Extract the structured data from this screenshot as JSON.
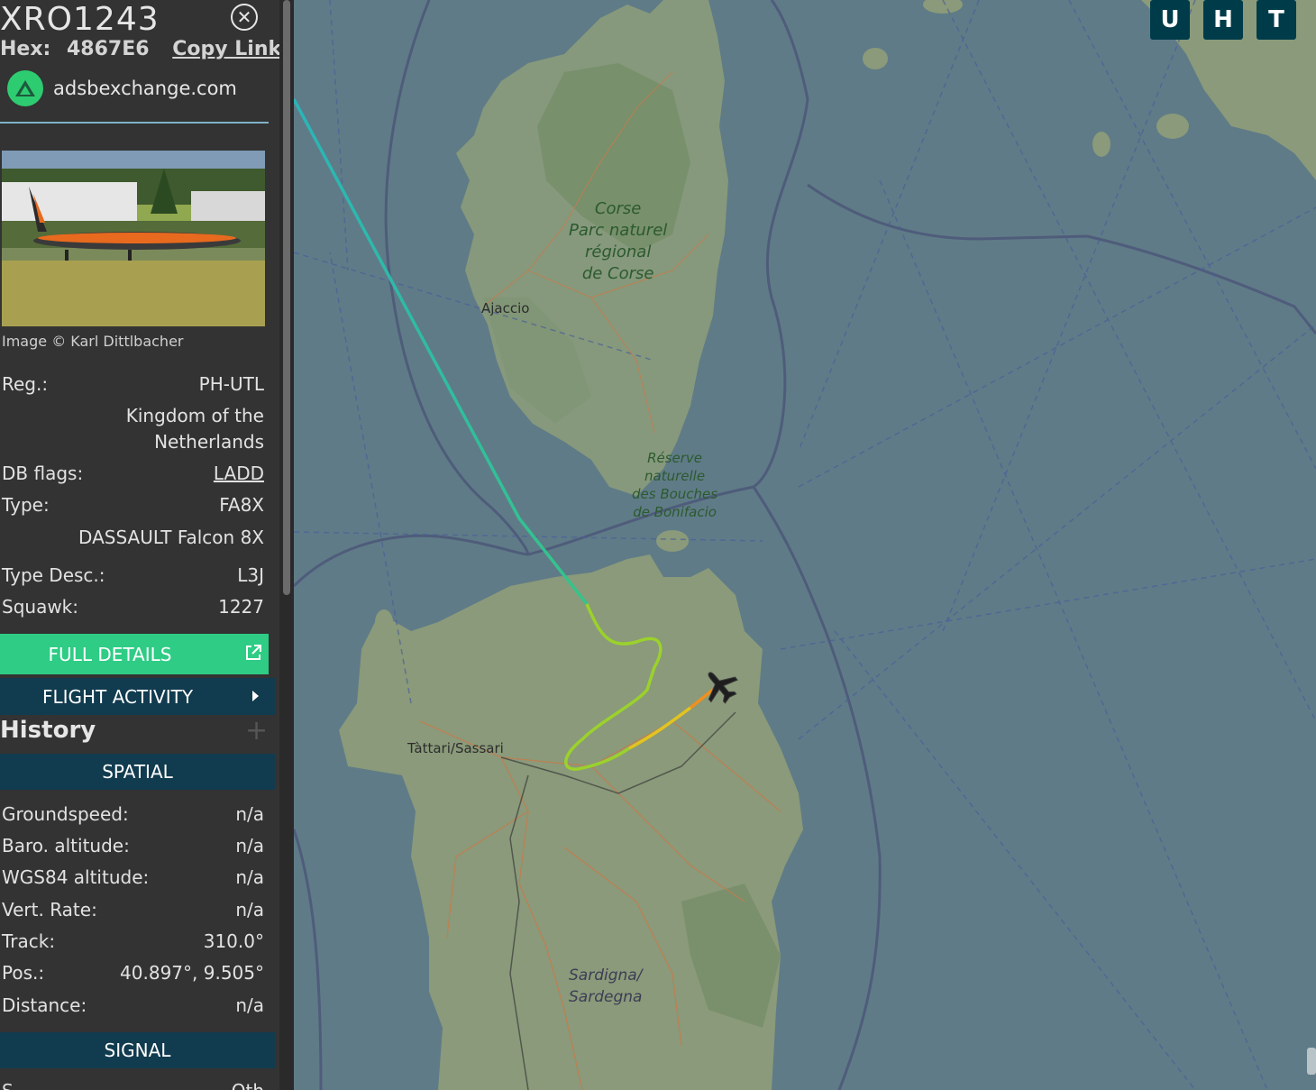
{
  "sidebar": {
    "callsign": "XRO1243",
    "hex_label": "Hex:",
    "hex_value": "4867E6",
    "copy_link": "Copy Link",
    "brand": "adsbexchange.com",
    "photo_credit": "Image © Karl Dittlbacher",
    "details": {
      "reg_label": "Reg.:",
      "reg_value": "PH-UTL",
      "country_line1": "Kingdom of the",
      "country_line2": "Netherlands",
      "db_flags_label": "DB flags:",
      "db_flags_value": "LADD",
      "type_label": "Type:",
      "type_value": "FA8X",
      "type_full": "DASSAULT Falcon 8X",
      "type_desc_label": "Type Desc.:",
      "type_desc_value": "L3J",
      "squawk_label": "Squawk:",
      "squawk_value": "1227"
    },
    "full_details_label": "FULL DETAILS",
    "flight_activity_label": "FLIGHT ACTIVITY",
    "history_title": "History",
    "history_add": "+",
    "spatial_label": "SPATIAL",
    "spatial": [
      {
        "label": "Groundspeed:",
        "value": "n/a"
      },
      {
        "label": "Baro. altitude:",
        "value": "n/a"
      },
      {
        "label": "WGS84 altitude:",
        "value": "n/a"
      },
      {
        "label": "Vert. Rate:",
        "value": "n/a"
      },
      {
        "label": "Track:",
        "value": "310.0°"
      },
      {
        "label": "Pos.:",
        "value": "40.897°, 9.505°"
      },
      {
        "label": "Distance:",
        "value": "n/a"
      }
    ],
    "signal_label": "SIGNAL",
    "signal_partial": {
      "label": "S",
      "value": "Oth"
    }
  },
  "map": {
    "buttons": [
      "U",
      "H",
      "T"
    ],
    "labels": {
      "corse_1": "Corse",
      "corse_2": "Parc naturel",
      "corse_3": "régional",
      "corse_4": "de Corse",
      "ajaccio": "Ajaccio",
      "bonif_1": "Réserve",
      "bonif_2": "naturelle",
      "bonif_3": "des Bouches",
      "bonif_4": "de Bonifacio",
      "sassari": "Tàttari/Sassari",
      "sard_1": "Sardigna/",
      "sard_2": "Sardegna"
    }
  },
  "colors": {
    "sidebar_bg": "#333333",
    "accent_green": "#2ecc85",
    "section_bar": "#113b4f",
    "map_sea": "#5f7b87",
    "map_land": "#8a9a7a",
    "track_cyan": "#2ab5b8",
    "track_orange": "#f0901e"
  }
}
